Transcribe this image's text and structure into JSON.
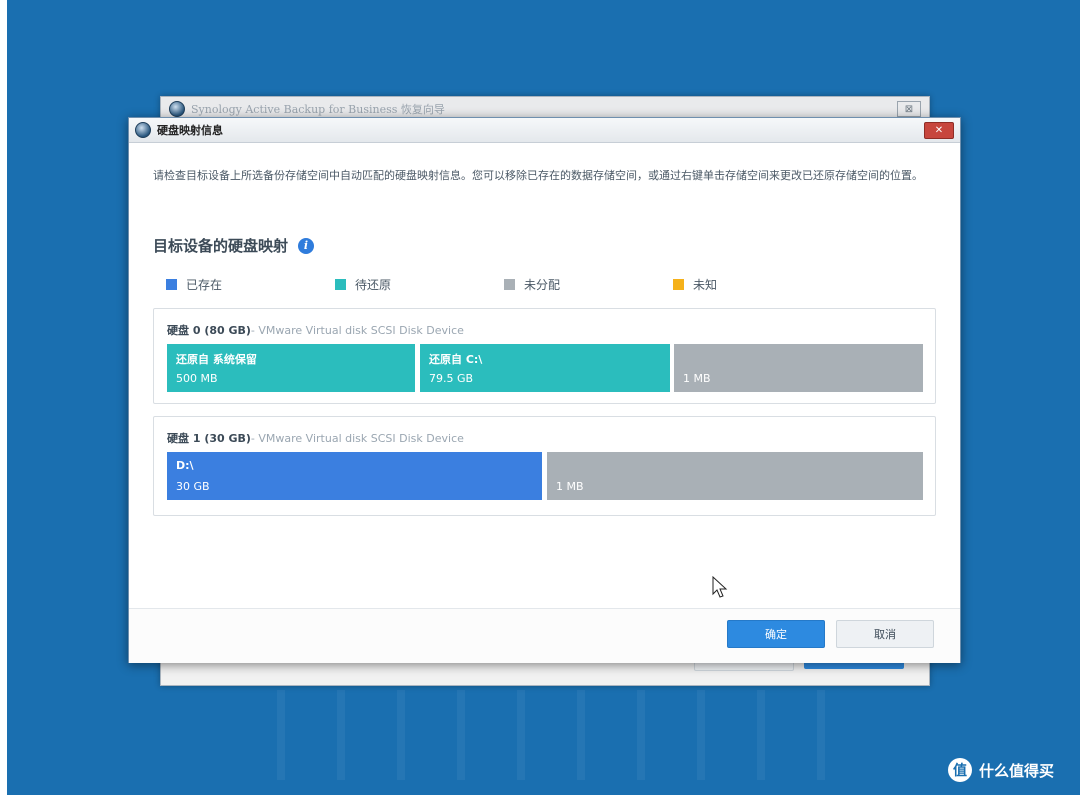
{
  "back_window": {
    "title": "Synology Active Backup for Business 恢复向导",
    "close_label": "⊠"
  },
  "dialog": {
    "title": "硬盘映射信息",
    "close_label": "✕",
    "description": "请检查目标设备上所选备份存储空间中自动匹配的硬盘映射信息。您可以移除已存在的数据存储空间，或通过右键单击存储空间来更改已还原存储空间的位置。",
    "section_title": "目标设备的硬盘映射",
    "info_icon_label": "i",
    "legend": [
      {
        "label": "已存在",
        "color": "#3b7fe0"
      },
      {
        "label": "待还原",
        "color": "#2bbdbd"
      },
      {
        "label": "未分配",
        "color": "#a9b0b6"
      },
      {
        "label": "未知",
        "color": "#f5b11a"
      }
    ],
    "disks": [
      {
        "name": "硬盘 0 (80 GB)",
        "model": "- VMware Virtual disk SCSI Disk Device",
        "partitions": [
          {
            "label": "还原自 系统保留",
            "size": "500 MB",
            "type": "to-restore"
          },
          {
            "label": "还原自 C:\\",
            "size": "79.5 GB",
            "type": "to-restore"
          },
          {
            "label": "",
            "size": "1 MB",
            "type": "unallocated"
          }
        ]
      },
      {
        "name": "硬盘 1 (30 GB)",
        "model": "- VMware Virtual disk SCSI Disk Device",
        "partitions": [
          {
            "label": "D:\\",
            "size": "30 GB",
            "type": "existing"
          },
          {
            "label": "",
            "size": "1 MB",
            "type": "unallocated"
          }
        ]
      }
    ],
    "buttons": {
      "ok": "确定",
      "cancel": "取消"
    }
  },
  "watermark": {
    "icon_char": "值",
    "text": "什么值得买"
  }
}
